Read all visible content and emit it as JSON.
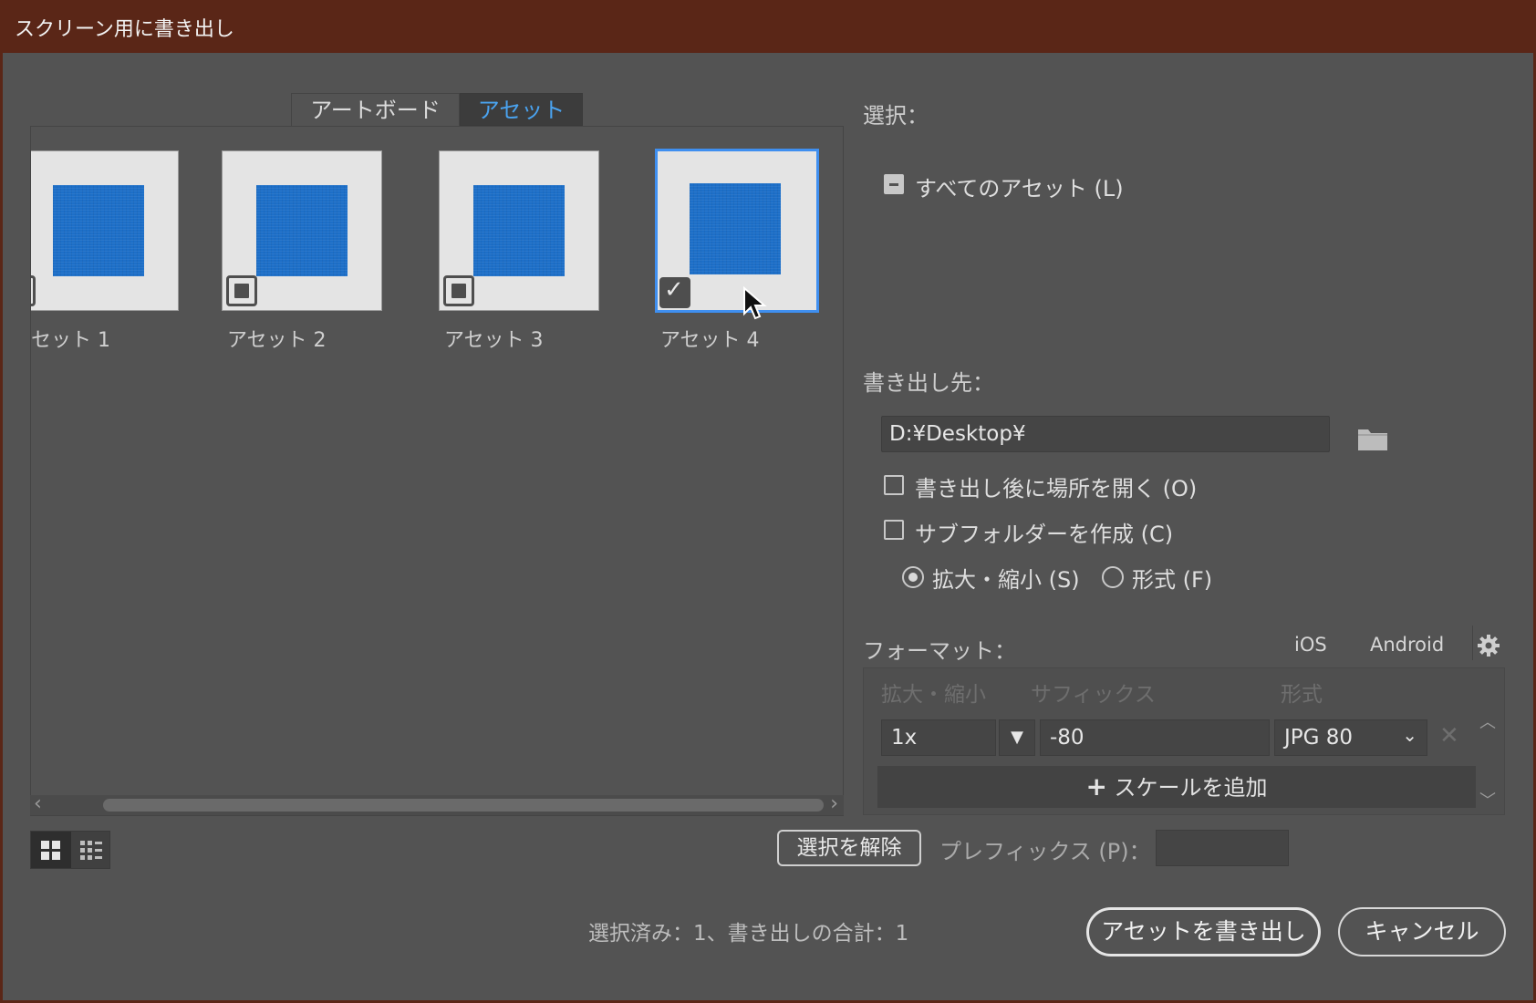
{
  "window": {
    "title": "スクリーン用に書き出し"
  },
  "tabs": [
    {
      "label": "アートボード",
      "active": false
    },
    {
      "label": "アセット",
      "active": true
    }
  ],
  "assets": [
    {
      "label": "セット 1",
      "checked": false,
      "selected": false
    },
    {
      "label": "アセット 2",
      "checked": false,
      "selected": false
    },
    {
      "label": "アセット 3",
      "checked": false,
      "selected": false
    },
    {
      "label": "アセット 4",
      "checked": true,
      "selected": true
    }
  ],
  "selection": {
    "heading": "選択：",
    "all_assets_label": "すべてのアセット (L)"
  },
  "export_to": {
    "heading": "書き出し先：",
    "path": "D:¥Desktop¥",
    "open_after_label": "書き出し後に場所を開く (O)",
    "create_subfolder_label": "サブフォルダーを作成 (C)",
    "scale_label": "拡大・縮小 (S)",
    "format_radio_label": "形式 (F)"
  },
  "formats": {
    "heading": "フォーマット：",
    "ios_label": "iOS",
    "android_label": "Android",
    "columns": {
      "scale": "拡大・縮小",
      "suffix": "サフィックス",
      "format": "形式"
    },
    "row": {
      "scale": "1x",
      "suffix": "-80",
      "format": "JPG 80"
    },
    "add_scale_label": "スケールを追加"
  },
  "deselect_label": "選択を解除",
  "prefix_label": "プレフィックス (P)：",
  "prefix_value": "",
  "status": "選択済み：1、書き出しの合計：1",
  "export_button": "アセットを書き出し",
  "cancel_button": "キャンセル",
  "colors": {
    "titlebar": "#5a2617",
    "accent": "#3f8ff0",
    "asset_fill": "#1d6fc8",
    "background": "#535353"
  }
}
